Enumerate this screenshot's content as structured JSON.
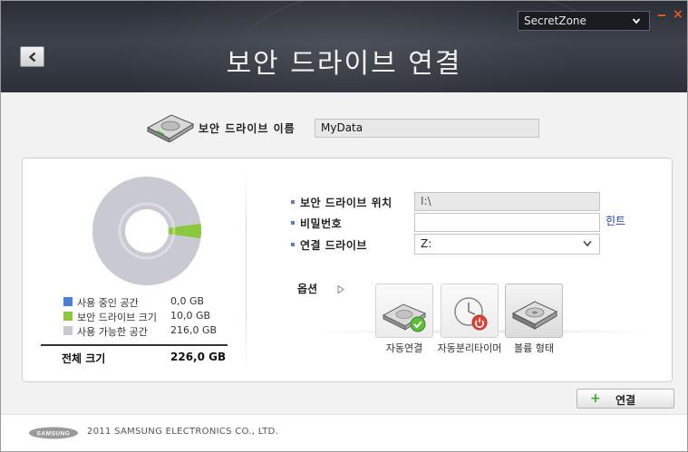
{
  "header": {
    "title": "보안 드라이브 연결",
    "account_select_value": "SecretZone"
  },
  "drive_name": {
    "label": "보안 드라이브 이름",
    "value": "MyData"
  },
  "usage": {
    "legend": [
      {
        "label": "사용 중인 공간",
        "value": "0,0 GB",
        "color": "#4a7fd4"
      },
      {
        "label": "보안 드라이브 크기",
        "value": "10,0 GB",
        "color": "#8dc63f"
      },
      {
        "label": "사용 가능한 공간",
        "value": "216,0 GB",
        "color": "#c9c9d3"
      }
    ],
    "total_label": "전체 크기",
    "total_value": "226,0 GB",
    "pie": {
      "used_gb": 0.0,
      "drive_gb": 10.0,
      "available_gb": 216.0
    }
  },
  "fields": {
    "location": {
      "label": "보안 드라이브 위치",
      "value": "I:\\"
    },
    "password": {
      "label": "비밀번호",
      "value": ""
    },
    "connect_drive": {
      "label": "연결 드라이브",
      "value": "Z:"
    },
    "hint_label": "힌트"
  },
  "options": {
    "label": "옵션",
    "items": [
      {
        "label": "자동연결"
      },
      {
        "label": "자동분리타이머"
      },
      {
        "label": "볼륨 형태"
      }
    ]
  },
  "actions": {
    "connect_label": "연결"
  },
  "footer": {
    "logo_text": "SAMSUNG",
    "copyright": "2011 SAMSUNG ELECTRONICS CO., LTD."
  },
  "colors": {
    "accent_orange": "#e05a1a",
    "link_blue": "#1a3dc8",
    "drive_green": "#8dc63f"
  }
}
